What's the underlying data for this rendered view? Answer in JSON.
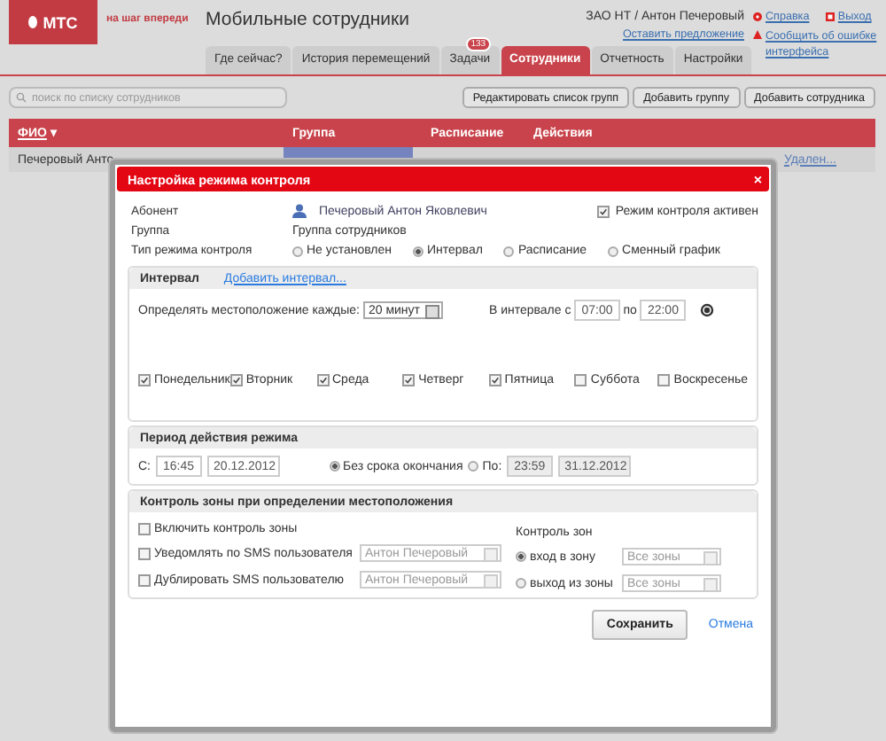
{
  "header": {
    "logo": "МТС",
    "slogan": "на шаг впереди",
    "app_title": "Мобильные сотрудники",
    "user": "ЗАО НТ / Антон Печеровый",
    "links": [
      {
        "kind": "help",
        "text": "Справка"
      },
      {
        "kind": "exit",
        "text": "Выход"
      },
      {
        "kind": "plain",
        "text": "Оставить предложение"
      },
      {
        "kind": "error",
        "text": "Сообщить об ошибке интерфейса"
      }
    ]
  },
  "tabs": [
    {
      "label": "Где сейчас?",
      "selected": false
    },
    {
      "label": "История перемещений",
      "selected": false
    },
    {
      "label": "Задачи",
      "selected": false,
      "badge": "133"
    },
    {
      "label": "Сотрудники",
      "selected": true
    },
    {
      "label": "Отчетность",
      "selected": false
    },
    {
      "label": "Настройки",
      "selected": false
    }
  ],
  "search": {
    "placeholder": "поиск по списку сотрудников"
  },
  "toolbar_buttons": [
    "Редактировать список групп",
    "Добавить группу",
    "Добавить сотрудника"
  ],
  "table": {
    "columns": [
      {
        "label": "ФИО",
        "sort": "▾"
      },
      {
        "label": "Группа"
      },
      {
        "label": "Расписание"
      },
      {
        "label": "Действия"
      }
    ],
    "rows": [
      {
        "name": "Печеровый Анто",
        "action": "Удален..."
      }
    ]
  },
  "dialog": {
    "title": "Настройка режима контроля",
    "close": "×",
    "subscriber_label": "Абонент",
    "subscriber": "Печеровый Антон Яковлевич",
    "active": {
      "label": "Режим контроля активен",
      "checked": true
    },
    "group_label": "Группа",
    "group": "Группа сотрудников",
    "mode_label": "Тип режима контроля",
    "modes": [
      {
        "label": "Не установлен",
        "selected": false
      },
      {
        "label": "Интервал",
        "selected": true
      },
      {
        "label": "Расписание",
        "selected": false
      },
      {
        "label": "Сменный график",
        "selected": false
      }
    ],
    "interval": {
      "title": "Интервал",
      "add_link": "Добавить интервал...",
      "every_label": "Определять местоположение каждые:",
      "every": "20 минут",
      "from_label": "В интервале с",
      "from": "07:00",
      "to_label": "по",
      "to": "22:00",
      "days": [
        {
          "label": "Понедельник",
          "checked": true
        },
        {
          "label": "Вторник",
          "checked": true
        },
        {
          "label": "Среда",
          "checked": true
        },
        {
          "label": "Четверг",
          "checked": true
        },
        {
          "label": "Пятница",
          "checked": true
        },
        {
          "label": "Суббота",
          "checked": false
        },
        {
          "label": "Воскресенье",
          "checked": false
        }
      ]
    },
    "period": {
      "title": "Период действия режима",
      "start_label": "С:",
      "start_time": "16:45",
      "start_date": "20.12.2012",
      "ends": [
        {
          "label": "Без срока окончания",
          "selected": true
        },
        {
          "label": "По:",
          "selected": false,
          "time": "23:59",
          "date": "31.12.2012"
        }
      ]
    },
    "zone": {
      "title": "Контроль зоны при определении местоположения",
      "enable": {
        "label": "Включить контроль зоны",
        "checked": false
      },
      "notify": [
        {
          "label": "Уведомлять по SMS пользователя",
          "checked": false,
          "user": "Антон Печеровый"
        },
        {
          "label": "Дублировать SMS пользователю",
          "checked": false,
          "user": "Антон Печеровый"
        }
      ],
      "control_label": "Контроль зон",
      "events": [
        {
          "label": "вход в зону",
          "selected": true,
          "zones": "Все зоны"
        },
        {
          "label": "выход из зоны",
          "selected": false,
          "zones": "Все зоны"
        }
      ]
    },
    "save": "Сохранить",
    "cancel": "Отмена"
  }
}
